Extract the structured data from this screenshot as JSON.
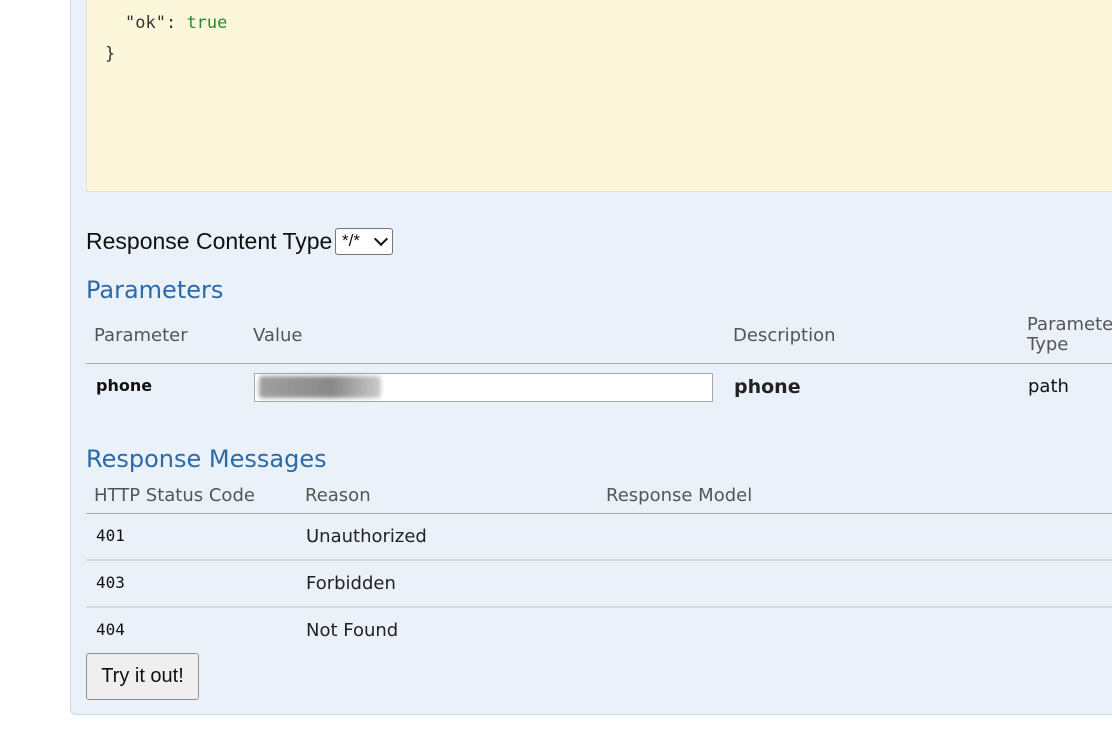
{
  "sample": {
    "line1_key": "\"ok\"",
    "line1_sep": ": ",
    "line1_value": "true",
    "line2": "}"
  },
  "response_content_type": {
    "label": "Response Content Type",
    "selected": "*/*"
  },
  "parameters": {
    "title": "Parameters",
    "headers": {
      "parameter": "Parameter",
      "value": "Value",
      "description": "Description",
      "type_line1": "Paramete",
      "type_line2": "Type"
    },
    "rows": [
      {
        "name": "phone",
        "value": "",
        "description": "phone",
        "type": "path"
      }
    ]
  },
  "response_messages": {
    "title": "Response Messages",
    "headers": {
      "code": "HTTP Status Code",
      "reason": "Reason",
      "model": "Response Model"
    },
    "rows": [
      {
        "code": "401",
        "reason": "Unauthorized"
      },
      {
        "code": "403",
        "reason": "Forbidden"
      },
      {
        "code": "404",
        "reason": "Not Found"
      }
    ]
  },
  "try_button": {
    "label": "Try it out!"
  }
}
